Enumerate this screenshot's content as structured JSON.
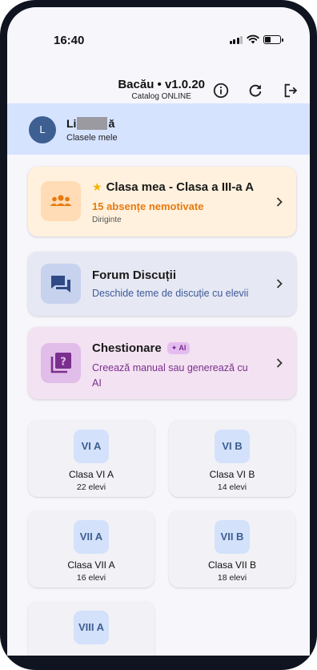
{
  "status_bar": {
    "time": "16:40"
  },
  "header": {
    "title": "Bacău • v1.0.20",
    "subtitle": "Catalog ONLINE"
  },
  "user": {
    "avatar_letter": "L",
    "name_prefix": "Li",
    "name_suffix": "ă",
    "subtitle": "Clasele mele"
  },
  "cards": {
    "my_class": {
      "title": "Clasa mea - Clasa a III-a A",
      "alert": "15 absențe nemotivate",
      "role": "Diriginte",
      "accent": "#e77a10"
    },
    "forum": {
      "title": "Forum Discuții",
      "subtitle": "Deschide teme de discuție cu elevii",
      "accent": "#3e5a9a"
    },
    "quiz": {
      "title": "Chestionare",
      "badge": "AI",
      "subtitle_line1": "Creează manual sau generează cu",
      "subtitle_line2": "AI",
      "accent": "#7a2f8f"
    }
  },
  "classes": [
    {
      "badge": "VI A",
      "name": "Clasa VI A",
      "count": "22 elevi"
    },
    {
      "badge": "VI B",
      "name": "Clasa VI B",
      "count": "14 elevi"
    },
    {
      "badge": "VII A",
      "name": "Clasa VII A",
      "count": "16 elevi"
    },
    {
      "badge": "VII B",
      "name": "Clasa VII B",
      "count": "18 elevi"
    },
    {
      "badge": "VIII A",
      "name": "",
      "count": ""
    }
  ]
}
